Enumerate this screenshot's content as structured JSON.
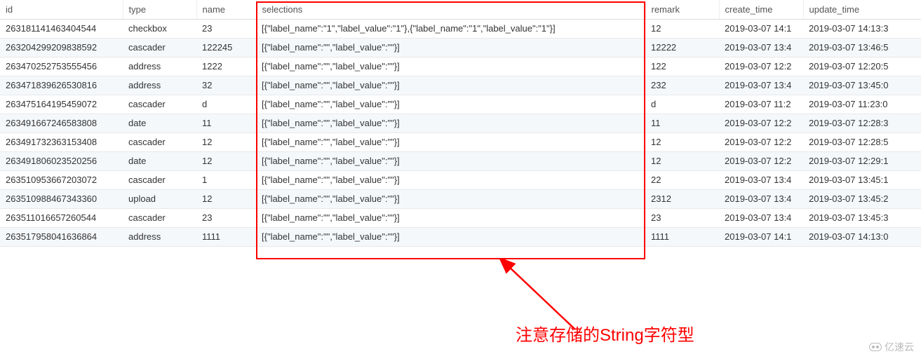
{
  "columns": {
    "id": "id",
    "type": "type",
    "name": "name",
    "selections": "selections",
    "remark": "remark",
    "create_time": "create_time",
    "update_time": "update_time"
  },
  "rows": [
    {
      "id": "263181141463404544",
      "type": "checkbox",
      "name": "23",
      "selections": "[{\"label_name\":\"1\",\"label_value\":\"1\"},{\"label_name\":\"1\",\"label_value\":\"1\"}]",
      "remark": "12",
      "create_time": "2019-03-07 14:1",
      "update_time": "2019-03-07 14:13:3"
    },
    {
      "id": "263204299209838592",
      "type": "cascader",
      "name": "122245",
      "selections": "[{\"label_name\":\"\",\"label_value\":\"\"}]",
      "remark": "12222",
      "create_time": "2019-03-07 13:4",
      "update_time": "2019-03-07 13:46:5"
    },
    {
      "id": "263470252753555456",
      "type": "address",
      "name": "1222",
      "selections": "[{\"label_name\":\"\",\"label_value\":\"\"}]",
      "remark": "122",
      "create_time": "2019-03-07 12:2",
      "update_time": "2019-03-07 12:20:5"
    },
    {
      "id": "263471839626530816",
      "type": "address",
      "name": "32",
      "selections": "[{\"label_name\":\"\",\"label_value\":\"\"}]",
      "remark": "232",
      "create_time": "2019-03-07 13:4",
      "update_time": "2019-03-07 13:45:0"
    },
    {
      "id": "263475164195459072",
      "type": "cascader",
      "name": "d",
      "selections": "[{\"label_name\":\"\",\"label_value\":\"\"}]",
      "remark": "d",
      "create_time": "2019-03-07 11:2",
      "update_time": "2019-03-07 11:23:0"
    },
    {
      "id": "263491667246583808",
      "type": "date",
      "name": "11",
      "selections": "[{\"label_name\":\"\",\"label_value\":\"\"}]",
      "remark": "11",
      "create_time": "2019-03-07 12:2",
      "update_time": "2019-03-07 12:28:3"
    },
    {
      "id": "263491732363153408",
      "type": "cascader",
      "name": "12",
      "selections": "[{\"label_name\":\"\",\"label_value\":\"\"}]",
      "remark": "12",
      "create_time": "2019-03-07 12:2",
      "update_time": "2019-03-07 12:28:5"
    },
    {
      "id": "263491806023520256",
      "type": "date",
      "name": "12",
      "selections": "[{\"label_name\":\"\",\"label_value\":\"\"}]",
      "remark": "12",
      "create_time": "2019-03-07 12:2",
      "update_time": "2019-03-07 12:29:1"
    },
    {
      "id": "263510953667203072",
      "type": "cascader",
      "name": "1",
      "selections": "[{\"label_name\":\"\",\"label_value\":\"\"}]",
      "remark": "22",
      "create_time": "2019-03-07 13:4",
      "update_time": "2019-03-07 13:45:1"
    },
    {
      "id": "263510988467343360",
      "type": "upload",
      "name": "12",
      "selections": "[{\"label_name\":\"\",\"label_value\":\"\"}]",
      "remark": "2312",
      "create_time": "2019-03-07 13:4",
      "update_time": "2019-03-07 13:45:2"
    },
    {
      "id": "263511016657260544",
      "type": "cascader",
      "name": "23",
      "selections": "[{\"label_name\":\"\",\"label_value\":\"\"}]",
      "remark": "23",
      "create_time": "2019-03-07 13:4",
      "update_time": "2019-03-07 13:45:3"
    },
    {
      "id": "263517958041636864",
      "type": "address",
      "name": "1111",
      "selections": "[{\"label_name\":\"\",\"label_value\":\"\"}]",
      "remark": "1111",
      "create_time": "2019-03-07 14:1",
      "update_time": "2019-03-07 14:13:0"
    }
  ],
  "annotation": {
    "caption": "注意存储的String字符型"
  },
  "watermark": {
    "text": "亿速云"
  }
}
